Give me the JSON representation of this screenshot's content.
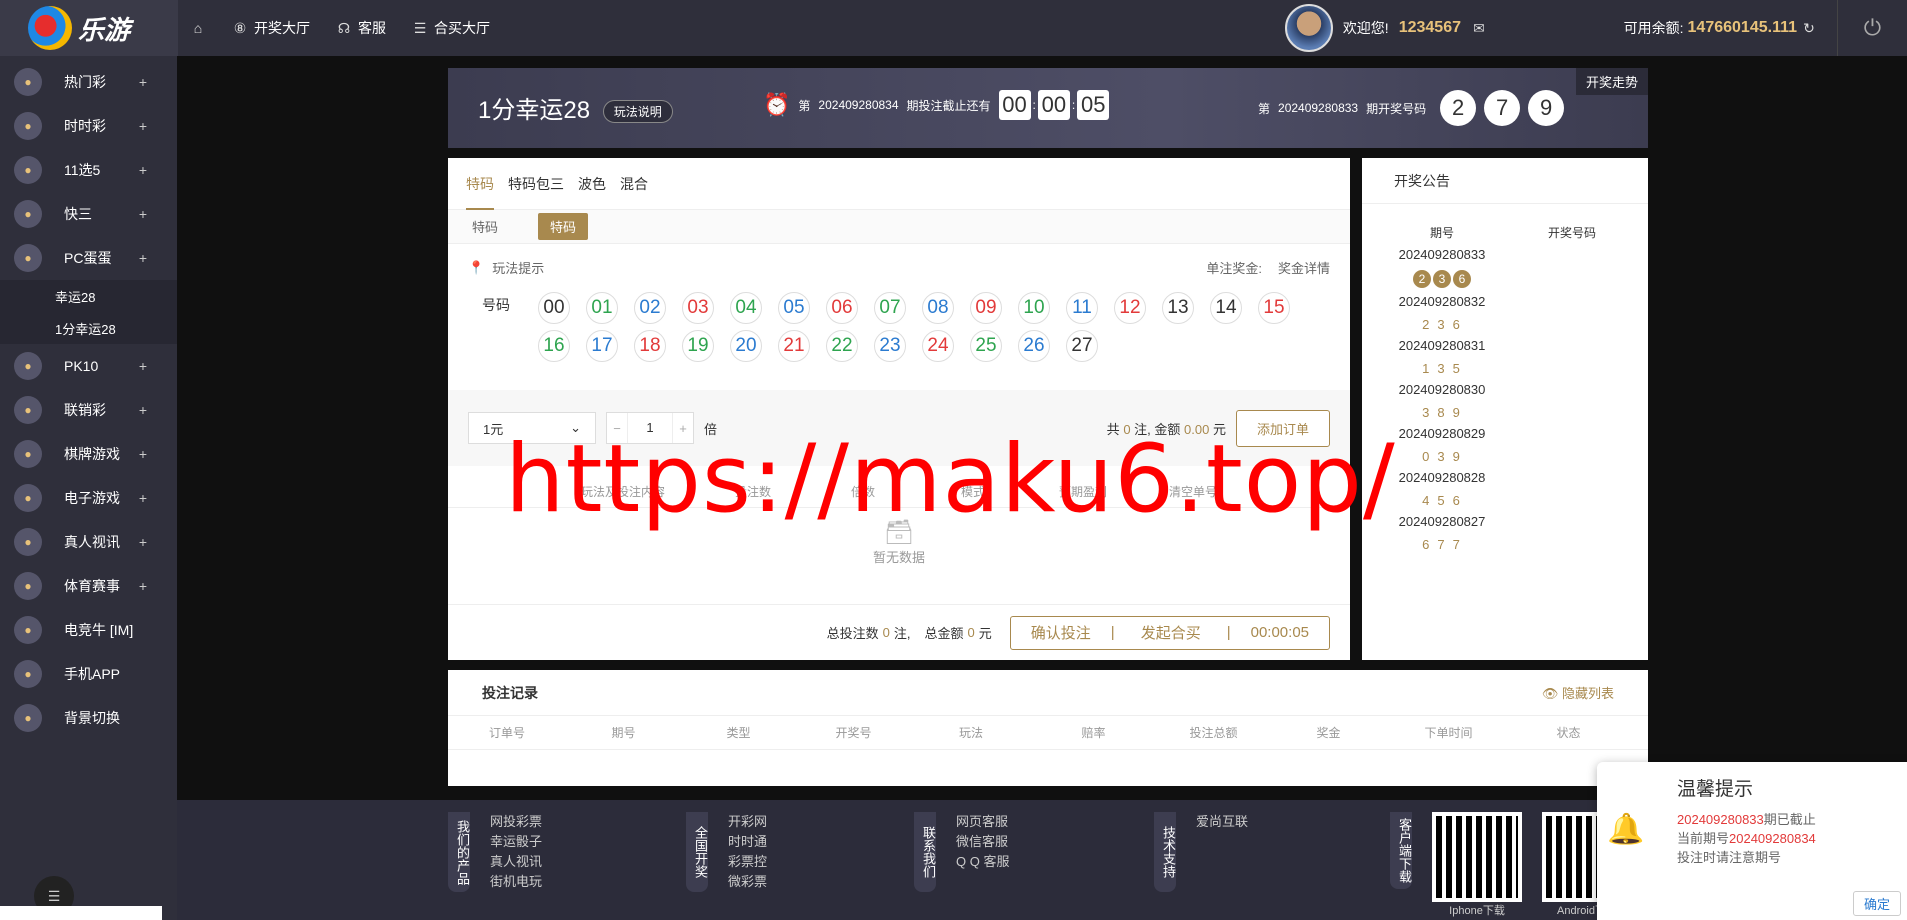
{
  "brand": {
    "name": "乐游"
  },
  "topnav": {
    "home_icon": "home-icon",
    "items": [
      "开奖大厅",
      "客服",
      "合买大厅"
    ]
  },
  "user": {
    "welcome": "欢迎您!",
    "username": "1234567",
    "balance_label": "可用余额:",
    "balance": "147660145.111"
  },
  "sidebar": {
    "items": [
      {
        "label": "热门彩",
        "icon": "fire-icon"
      },
      {
        "label": "时时彩",
        "icon": "clock-icon"
      },
      {
        "label": "11选5",
        "icon": "lottery-icon"
      },
      {
        "label": "快三",
        "icon": "dice-icon"
      },
      {
        "label": "PC蛋蛋",
        "icon": "egg-icon"
      }
    ],
    "sub_items": [
      "幸运28",
      "1分幸运28"
    ],
    "items2": [
      {
        "label": "PK10",
        "icon": "race-icon",
        "plus": true
      },
      {
        "label": "联销彩",
        "icon": "dots-icon",
        "plus": true
      },
      {
        "label": "棋牌游戏",
        "icon": "cards-icon",
        "plus": true
      },
      {
        "label": "电子游戏",
        "icon": "slot-icon",
        "plus": true
      },
      {
        "label": "真人视讯",
        "icon": "person-icon",
        "plus": true
      },
      {
        "label": "体育赛事",
        "icon": "ball-icon",
        "plus": true
      },
      {
        "label": "电竞牛 [IM]",
        "icon": "bull-icon",
        "plus": false
      },
      {
        "label": "手机APP",
        "icon": "phone-icon",
        "plus": false
      },
      {
        "label": "背景切换",
        "icon": "monitor-icon",
        "plus": false
      }
    ]
  },
  "hero": {
    "title": "1分幸运28",
    "rules_btn": "玩法说明",
    "period_prefix": "第",
    "current_period": "202409280834",
    "deadline_text": "期投注截止还有",
    "countdown": [
      "00",
      "00",
      "05"
    ],
    "last_period": "202409280833",
    "last_text": "期开奖号码",
    "last_balls": [
      "2",
      "7",
      "9"
    ],
    "trend_btn": "开奖走势"
  },
  "bet": {
    "tabs": [
      "特码",
      "特码包三",
      "波色",
      "混合"
    ],
    "subtabs": [
      "特码",
      "特码"
    ],
    "hint": "玩法提示",
    "single_prize": "单注奖金:",
    "prize_detail": "奖金详情",
    "numbers_label": "号码",
    "numbers": [
      {
        "n": "00",
        "c": "c-gray"
      },
      {
        "n": "01",
        "c": "c-green"
      },
      {
        "n": "02",
        "c": "c-blue"
      },
      {
        "n": "03",
        "c": "c-red"
      },
      {
        "n": "04",
        "c": "c-green"
      },
      {
        "n": "05",
        "c": "c-blue"
      },
      {
        "n": "06",
        "c": "c-red"
      },
      {
        "n": "07",
        "c": "c-green"
      },
      {
        "n": "08",
        "c": "c-blue"
      },
      {
        "n": "09",
        "c": "c-red"
      },
      {
        "n": "10",
        "c": "c-green"
      },
      {
        "n": "11",
        "c": "c-blue"
      },
      {
        "n": "12",
        "c": "c-red"
      },
      {
        "n": "13",
        "c": "c-gray"
      },
      {
        "n": "14",
        "c": "c-gray"
      },
      {
        "n": "15",
        "c": "c-red"
      },
      {
        "n": "16",
        "c": "c-green"
      },
      {
        "n": "17",
        "c": "c-blue"
      },
      {
        "n": "18",
        "c": "c-red"
      },
      {
        "n": "19",
        "c": "c-green"
      },
      {
        "n": "20",
        "c": "c-blue"
      },
      {
        "n": "21",
        "c": "c-red"
      },
      {
        "n": "22",
        "c": "c-green"
      },
      {
        "n": "23",
        "c": "c-blue"
      },
      {
        "n": "24",
        "c": "c-red"
      },
      {
        "n": "25",
        "c": "c-green"
      },
      {
        "n": "26",
        "c": "c-blue"
      },
      {
        "n": "27",
        "c": "c-gray"
      }
    ],
    "unit": "1元",
    "multiplier": "1",
    "multiplier_suffix": "倍",
    "summary_prefix": "共",
    "summary_count": "0",
    "summary_mid": "注, 金额",
    "summary_amount": "0.00",
    "summary_suffix": "元",
    "add_order": "添加订单",
    "order_cols": [
      "玩法及投注内容",
      "投注数",
      "倍数",
      "模式",
      "预期盈利",
      "清空单号"
    ],
    "empty_text": "暂无数据",
    "total_prefix": "总投注数",
    "total_count": "0",
    "total_mid": "注,",
    "total_amount_label": "总金额",
    "total_amount": "0",
    "total_suffix": "元",
    "confirm": "确认投注",
    "group_buy": "发起合买",
    "timer": "00:00:05"
  },
  "draws": {
    "title": "开奖公告",
    "col_period": "期号",
    "col_numbers": "开奖号码",
    "rows": [
      {
        "period": "202409280833",
        "nums": [
          "2",
          "3",
          "6"
        ],
        "highlight": true
      },
      {
        "period": "202409280832",
        "nums": [
          "2",
          "3",
          "6"
        ]
      },
      {
        "period": "202409280831",
        "nums": [
          "1",
          "3",
          "5"
        ]
      },
      {
        "period": "202409280830",
        "nums": [
          "3",
          "8",
          "9"
        ]
      },
      {
        "period": "202409280829",
        "nums": [
          "0",
          "3",
          "9"
        ]
      },
      {
        "period": "202409280828",
        "nums": [
          "4",
          "5",
          "6"
        ]
      },
      {
        "period": "202409280827",
        "nums": [
          "6",
          "7",
          "7"
        ]
      }
    ]
  },
  "records": {
    "title": "投注记录",
    "hide": "隐藏列表",
    "cols": [
      "订单号",
      "期号",
      "类型",
      "开奖号",
      "玩法",
      "赔率",
      "投注总额",
      "奖金",
      "下单时间",
      "状态"
    ]
  },
  "footer": {
    "groups": [
      {
        "tag": "我们的产品",
        "links": [
          "网投彩票",
          "幸运骰子",
          "真人视讯",
          "街机电玩"
        ]
      },
      {
        "tag": "全国开奖",
        "links": [
          "开彩网",
          "时时通",
          "彩票控",
          "微彩票"
        ]
      },
      {
        "tag": "联系我们",
        "links": [
          "网页客服",
          "微信客服",
          "Q Q 客服"
        ]
      },
      {
        "tag": "技术支持",
        "links": [
          "爱尚互联"
        ]
      }
    ],
    "download_tag": "客户端下载",
    "qr_labels": [
      "Iphone下载",
      "Android下载"
    ]
  },
  "toast": {
    "title": "温馨提示",
    "line1_period": "202409280833",
    "line1_suffix": "期已截止",
    "line2_prefix": "当前期号",
    "line2_period": "202409280834",
    "line3": "投注时请注意期号",
    "ok": "确定"
  },
  "watermark": "https://maku6.top/"
}
